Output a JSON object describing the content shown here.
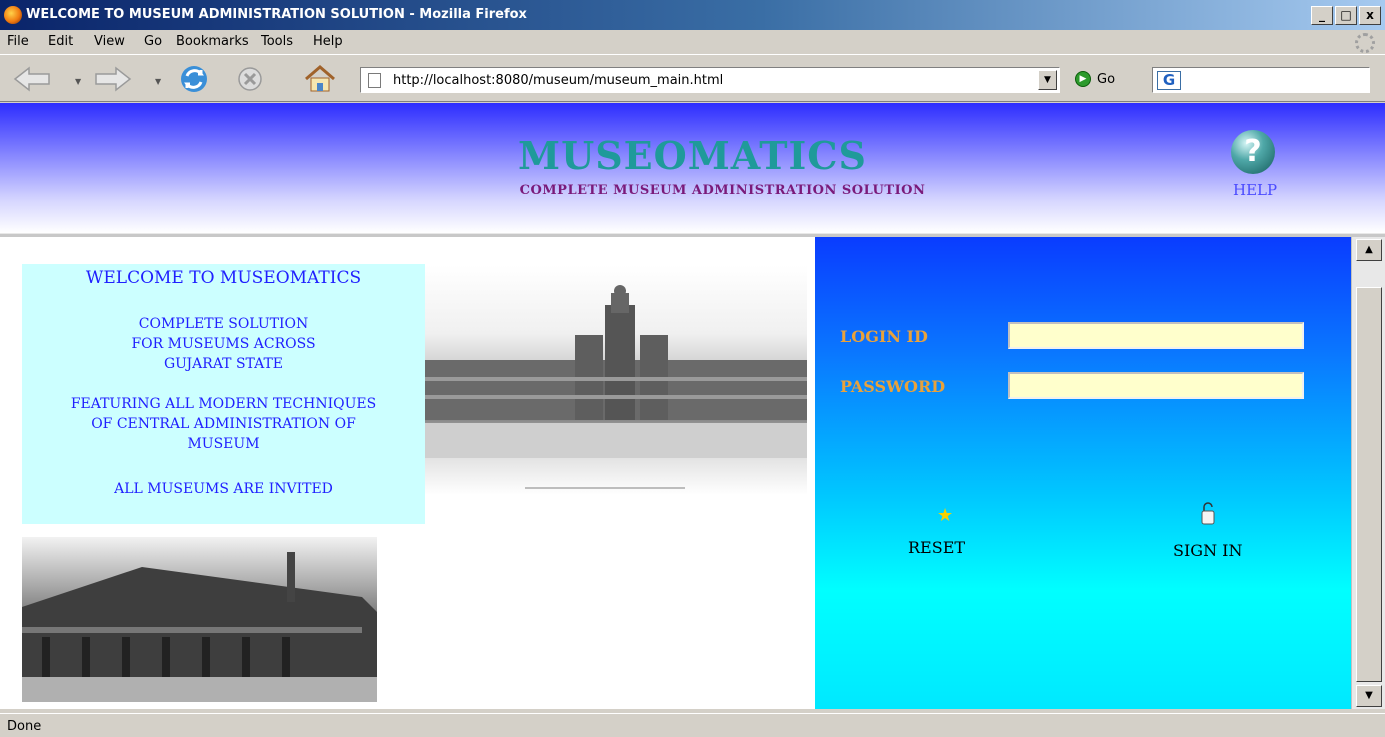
{
  "window": {
    "title": "WELCOME TO MUSEUM ADMINISTRATION SOLUTION - Mozilla Firefox",
    "minimize": "_",
    "maximize": "И",
    "close": "x"
  },
  "menu": [
    "File",
    "Edit",
    "View",
    "Go",
    "Bookmarks",
    "Tools",
    "Help"
  ],
  "toolbar": {
    "url": "http://localhost:8080/museum/museum_main.html",
    "go_label": "Go",
    "search_engine_glyph": "G"
  },
  "header": {
    "brand": "MUSEOMATICS",
    "tagline": "COMPLETE MUSEUM ADMINISTRATION SOLUTION",
    "help_label": "HELP",
    "help_glyph": "?"
  },
  "welcome": {
    "title": "WELCOME TO MUSEOMATICS",
    "block1": [
      "COMPLETE SOLUTION",
      "FOR MUSEUMS ACROSS",
      "GUJARAT STATE"
    ],
    "block2": [
      "FEATURING ALL MODERN TECHNIQUES",
      "OF CENTRAL ADMINISTRATION OF",
      "MUSEUM"
    ],
    "block3": [
      "ALL MUSEUMS ARE INVITED"
    ]
  },
  "login": {
    "login_id_label": "LOGIN ID",
    "password_label": "PASSWORD",
    "login_id_value": "",
    "password_value": "",
    "reset_label": "RESET",
    "signin_label": "SIGN IN"
  },
  "status": {
    "text": "Done"
  },
  "colors": {
    "brand": "#1f9a9a",
    "tagline": "#7a1a7a",
    "welcome_text": "#2020ff",
    "welcome_bg": "#ccffff",
    "login_label": "#e8a23c",
    "field_bg": "#ffffcc"
  }
}
